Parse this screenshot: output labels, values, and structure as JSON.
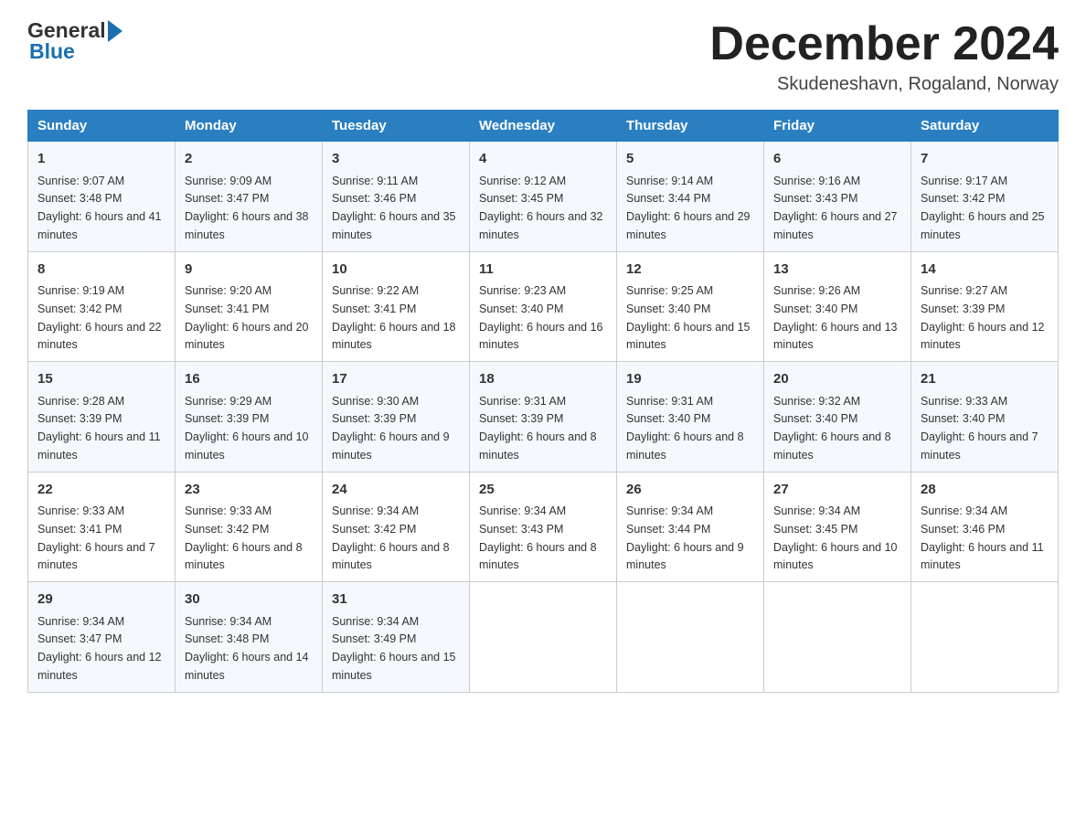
{
  "header": {
    "logo": {
      "general": "General",
      "blue": "Blue"
    },
    "title": "December 2024",
    "location": "Skudeneshavn, Rogaland, Norway"
  },
  "calendar": {
    "days_of_week": [
      "Sunday",
      "Monday",
      "Tuesday",
      "Wednesday",
      "Thursday",
      "Friday",
      "Saturday"
    ],
    "weeks": [
      [
        {
          "day": "1",
          "sunrise": "9:07 AM",
          "sunset": "3:48 PM",
          "daylight": "6 hours and 41 minutes."
        },
        {
          "day": "2",
          "sunrise": "9:09 AM",
          "sunset": "3:47 PM",
          "daylight": "6 hours and 38 minutes."
        },
        {
          "day": "3",
          "sunrise": "9:11 AM",
          "sunset": "3:46 PM",
          "daylight": "6 hours and 35 minutes."
        },
        {
          "day": "4",
          "sunrise": "9:12 AM",
          "sunset": "3:45 PM",
          "daylight": "6 hours and 32 minutes."
        },
        {
          "day": "5",
          "sunrise": "9:14 AM",
          "sunset": "3:44 PM",
          "daylight": "6 hours and 29 minutes."
        },
        {
          "day": "6",
          "sunrise": "9:16 AM",
          "sunset": "3:43 PM",
          "daylight": "6 hours and 27 minutes."
        },
        {
          "day": "7",
          "sunrise": "9:17 AM",
          "sunset": "3:42 PM",
          "daylight": "6 hours and 25 minutes."
        }
      ],
      [
        {
          "day": "8",
          "sunrise": "9:19 AM",
          "sunset": "3:42 PM",
          "daylight": "6 hours and 22 minutes."
        },
        {
          "day": "9",
          "sunrise": "9:20 AM",
          "sunset": "3:41 PM",
          "daylight": "6 hours and 20 minutes."
        },
        {
          "day": "10",
          "sunrise": "9:22 AM",
          "sunset": "3:41 PM",
          "daylight": "6 hours and 18 minutes."
        },
        {
          "day": "11",
          "sunrise": "9:23 AM",
          "sunset": "3:40 PM",
          "daylight": "6 hours and 16 minutes."
        },
        {
          "day": "12",
          "sunrise": "9:25 AM",
          "sunset": "3:40 PM",
          "daylight": "6 hours and 15 minutes."
        },
        {
          "day": "13",
          "sunrise": "9:26 AM",
          "sunset": "3:40 PM",
          "daylight": "6 hours and 13 minutes."
        },
        {
          "day": "14",
          "sunrise": "9:27 AM",
          "sunset": "3:39 PM",
          "daylight": "6 hours and 12 minutes."
        }
      ],
      [
        {
          "day": "15",
          "sunrise": "9:28 AM",
          "sunset": "3:39 PM",
          "daylight": "6 hours and 11 minutes."
        },
        {
          "day": "16",
          "sunrise": "9:29 AM",
          "sunset": "3:39 PM",
          "daylight": "6 hours and 10 minutes."
        },
        {
          "day": "17",
          "sunrise": "9:30 AM",
          "sunset": "3:39 PM",
          "daylight": "6 hours and 9 minutes."
        },
        {
          "day": "18",
          "sunrise": "9:31 AM",
          "sunset": "3:39 PM",
          "daylight": "6 hours and 8 minutes."
        },
        {
          "day": "19",
          "sunrise": "9:31 AM",
          "sunset": "3:40 PM",
          "daylight": "6 hours and 8 minutes."
        },
        {
          "day": "20",
          "sunrise": "9:32 AM",
          "sunset": "3:40 PM",
          "daylight": "6 hours and 8 minutes."
        },
        {
          "day": "21",
          "sunrise": "9:33 AM",
          "sunset": "3:40 PM",
          "daylight": "6 hours and 7 minutes."
        }
      ],
      [
        {
          "day": "22",
          "sunrise": "9:33 AM",
          "sunset": "3:41 PM",
          "daylight": "6 hours and 7 minutes."
        },
        {
          "day": "23",
          "sunrise": "9:33 AM",
          "sunset": "3:42 PM",
          "daylight": "6 hours and 8 minutes."
        },
        {
          "day": "24",
          "sunrise": "9:34 AM",
          "sunset": "3:42 PM",
          "daylight": "6 hours and 8 minutes."
        },
        {
          "day": "25",
          "sunrise": "9:34 AM",
          "sunset": "3:43 PM",
          "daylight": "6 hours and 8 minutes."
        },
        {
          "day": "26",
          "sunrise": "9:34 AM",
          "sunset": "3:44 PM",
          "daylight": "6 hours and 9 minutes."
        },
        {
          "day": "27",
          "sunrise": "9:34 AM",
          "sunset": "3:45 PM",
          "daylight": "6 hours and 10 minutes."
        },
        {
          "day": "28",
          "sunrise": "9:34 AM",
          "sunset": "3:46 PM",
          "daylight": "6 hours and 11 minutes."
        }
      ],
      [
        {
          "day": "29",
          "sunrise": "9:34 AM",
          "sunset": "3:47 PM",
          "daylight": "6 hours and 12 minutes."
        },
        {
          "day": "30",
          "sunrise": "9:34 AM",
          "sunset": "3:48 PM",
          "daylight": "6 hours and 14 minutes."
        },
        {
          "day": "31",
          "sunrise": "9:34 AM",
          "sunset": "3:49 PM",
          "daylight": "6 hours and 15 minutes."
        },
        null,
        null,
        null,
        null
      ]
    ]
  }
}
